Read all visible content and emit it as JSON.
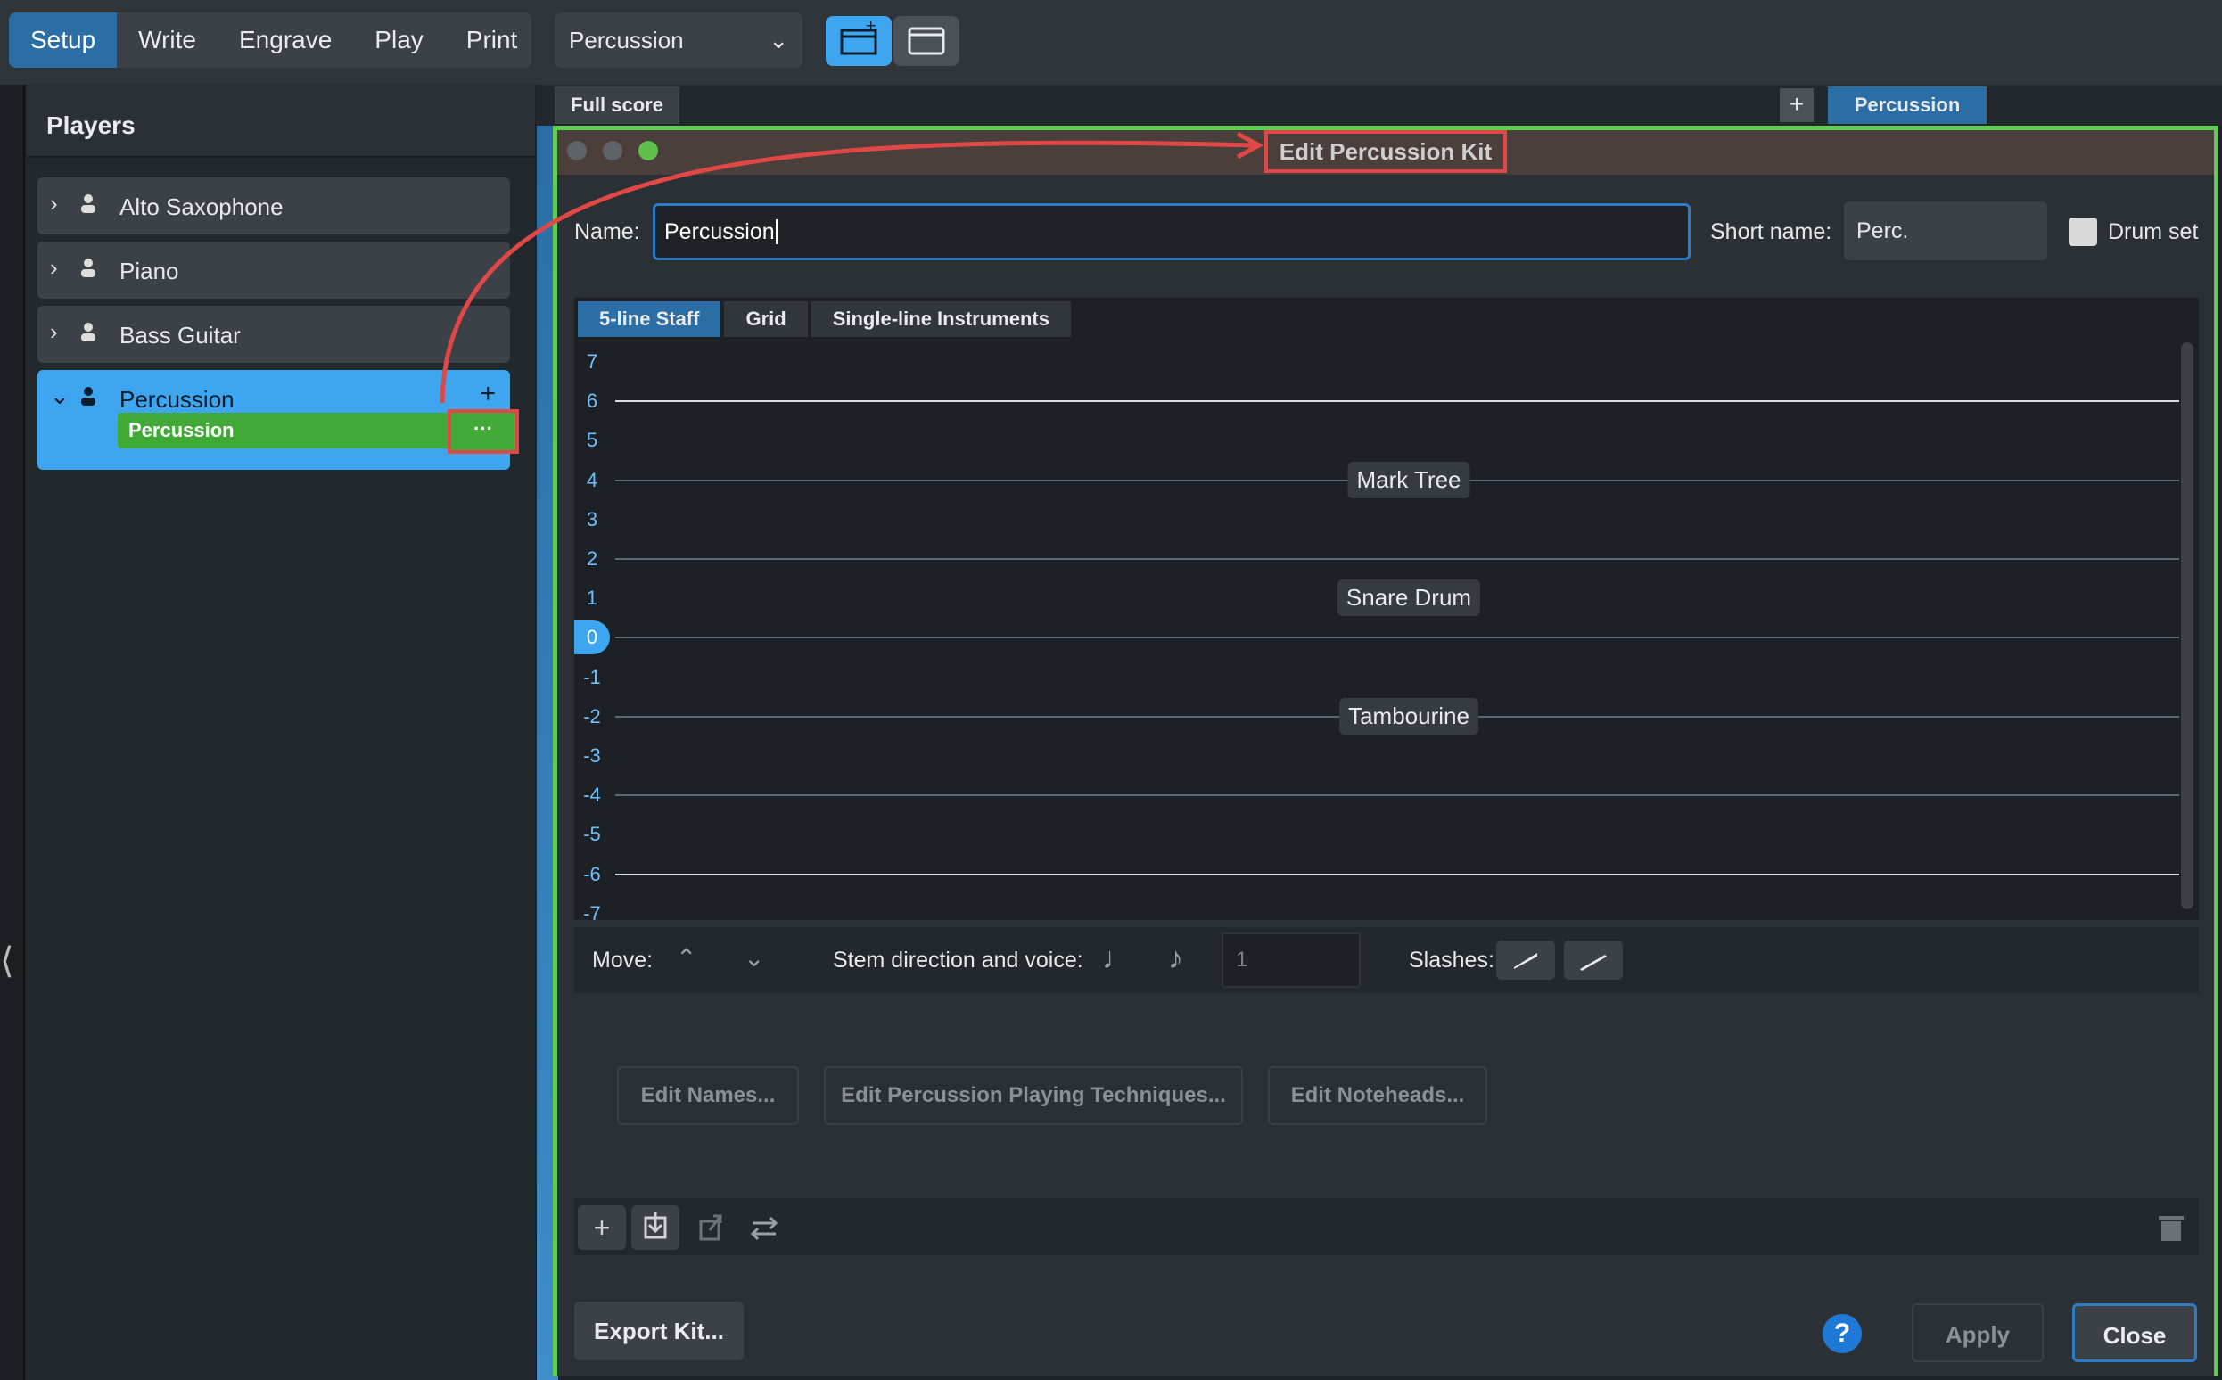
{
  "modes": [
    "Setup",
    "Write",
    "Engrave",
    "Play",
    "Print"
  ],
  "layout_select": "Percussion",
  "players_panel": {
    "title": "Players",
    "players": [
      "Alto Saxophone",
      "Piano",
      "Bass Guitar",
      "Percussion"
    ],
    "selected_instrument": "Percussion",
    "more_label": "···"
  },
  "tabs": {
    "full_score": "Full score",
    "percussion": "Percussion"
  },
  "dialog": {
    "title": "Edit Percussion Kit",
    "name_label": "Name:",
    "name_value": "Percussion",
    "short_name_label": "Short name:",
    "short_name_value": "Perc.",
    "drum_set_label": "Drum set",
    "view_tabs": [
      "5-line Staff",
      "Grid",
      "Single-line Instruments"
    ],
    "rows": [
      "7",
      "6",
      "5",
      "4",
      "3",
      "2",
      "1",
      "0",
      "-1",
      "-2",
      "-3",
      "-4",
      "-5",
      "-6",
      "-7"
    ],
    "selected_row": "0",
    "instruments": [
      {
        "name": "Mark Tree",
        "row": "4"
      },
      {
        "name": "Snare Drum",
        "row": "1"
      },
      {
        "name": "Tambourine",
        "row": "-2"
      }
    ],
    "move_label": "Move:",
    "stem_label": "Stem direction and voice:",
    "voice_value": "1",
    "slashes_label": "Slashes:",
    "edit_names": "Edit Names...",
    "edit_techniques": "Edit Percussion Playing Techniques...",
    "edit_noteheads": "Edit Noteheads...",
    "export_kit": "Export Kit...",
    "help": "?",
    "apply": "Apply",
    "close": "Close"
  },
  "colors": {
    "accent": "#2b6ea6",
    "selection": "#3ea6f0",
    "instrument_green": "#41a935",
    "highlight_red": "#e04747",
    "dialog_border": "#5fcd52"
  }
}
